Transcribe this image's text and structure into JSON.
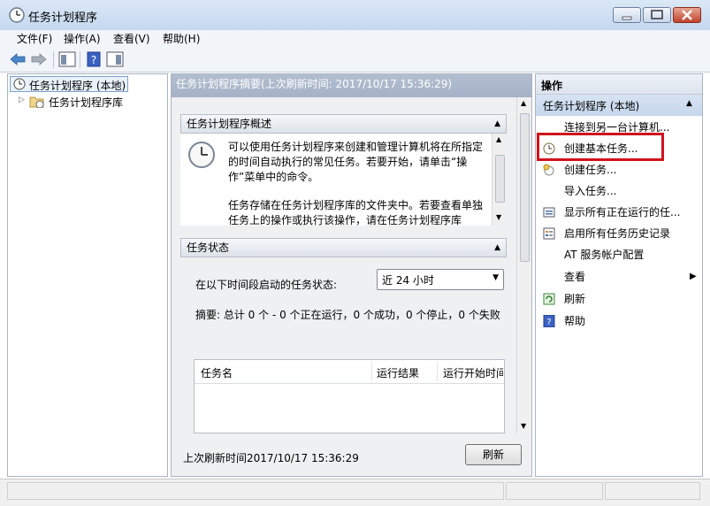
{
  "window": {
    "title": "任务计划程序"
  },
  "menu": [
    "文件(F)",
    "操作(A)",
    "查看(V)",
    "帮助(H)"
  ],
  "tree": {
    "root": "任务计划程序 (本地)",
    "child": "任务计划程序库"
  },
  "center": {
    "header": "任务计划程序摘要(上次刷新时间: 2017/10/17 15:36:29)",
    "overview_title": "任务计划程序概述",
    "overview_p1": "可以使用任务计划程序来创建和管理计算机将在所指定的时间自动执行的常见任务。若要开始，请单击“操作”菜单中的命令。",
    "overview_p2": "任务存储在任务计划程序库的文件夹中。若要查看单独任务上的操作或执行该操作，请在任务计划程序库",
    "status_title": "任务状态",
    "status_label": "在以下时间段启动的任务状态:",
    "period_select": "近 24 小时",
    "summary": "摘要: 总计 0 个 - 0 个正在运行，0 个成功，0 个停止，0 个失败",
    "table_headers": [
      "任务名",
      "运行结果",
      "运行开始时间"
    ],
    "footer_text": "上次刷新时间2017/10/17 15:36:29",
    "refresh_button": "刷新"
  },
  "actions": {
    "header": "操作",
    "group": "任务计划程序 (本地)",
    "items": [
      {
        "label": "连接到另一台计算机...",
        "icon": "none"
      },
      {
        "label": "创建基本任务...",
        "icon": "clock-wizard-icon"
      },
      {
        "label": "创建任务...",
        "icon": "task-icon"
      },
      {
        "label": "导入任务...",
        "icon": "none"
      },
      {
        "label": "显示所有正在运行的任...",
        "icon": "running-tasks-icon"
      },
      {
        "label": "启用所有任务历史记录",
        "icon": "history-icon"
      },
      {
        "label": "AT 服务帐户配置",
        "icon": "none"
      },
      {
        "label": "查看",
        "icon": "none"
      },
      {
        "label": "刷新",
        "icon": "refresh-icon"
      },
      {
        "label": "帮助",
        "icon": "help-icon"
      }
    ]
  },
  "colors": {
    "highlight_box": "#d0121b",
    "header_bg": "#a9b6c9"
  }
}
